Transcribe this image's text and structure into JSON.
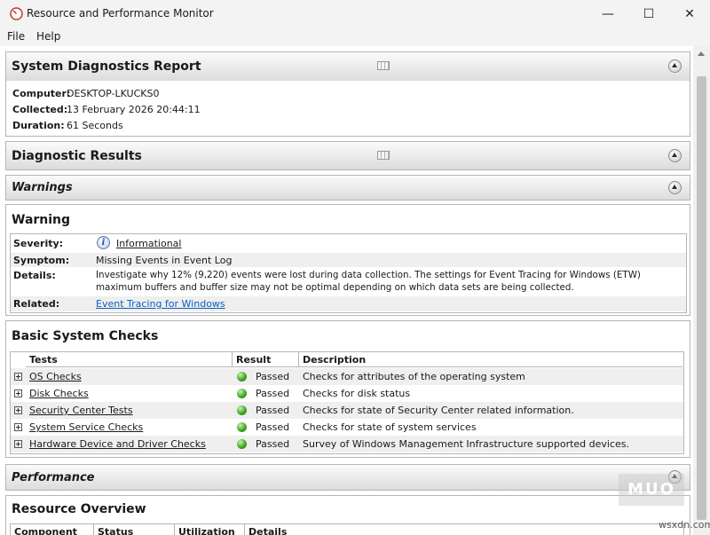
{
  "window": {
    "title": "Resource and Performance Monitor",
    "controls": {
      "minimize": "—",
      "maximize": "☐",
      "close": "✕"
    }
  },
  "menu": {
    "file": "File",
    "help": "Help"
  },
  "report": {
    "title": "System Diagnostics Report",
    "computer_label": "Computer:",
    "computer_value": "DESKTOP-LKUCKS0",
    "collected_label": "Collected:",
    "collected_value": "13 February 2026 20:44:11",
    "duration_label": "Duration:",
    "duration_value": "61 Seconds"
  },
  "diagnostic_results": {
    "title": "Diagnostic Results"
  },
  "warnings": {
    "title": "Warnings"
  },
  "warning": {
    "title": "Warning",
    "severity_label": "Severity:",
    "severity_value": "Informational",
    "symptom_label": "Symptom:",
    "symptom_value": "Missing Events in Event Log",
    "details_label": "Details:",
    "details_line1": "Investigate why 12% (9,220) events were lost during data collection. The settings for Event Tracing for Windows (ETW)",
    "details_line2": "maximum buffers and buffer size may not be optimal depending on which data sets are being collected.",
    "related_label": "Related:",
    "related_value": "Event Tracing for Windows"
  },
  "basic_checks": {
    "title": "Basic System Checks",
    "columns": {
      "tests": "Tests",
      "result": "Result",
      "description": "Description"
    },
    "rows": [
      {
        "test": "OS Checks",
        "result": "Passed",
        "description": "Checks for attributes of the operating system"
      },
      {
        "test": "Disk Checks",
        "result": "Passed",
        "description": "Checks for disk status"
      },
      {
        "test": "Security Center Tests",
        "result": "Passed",
        "description": "Checks for state of Security Center related information."
      },
      {
        "test": "System Service Checks",
        "result": "Passed",
        "description": "Checks for state of system services"
      },
      {
        "test": "Hardware Device and Driver Checks",
        "result": "Passed",
        "description": "Survey of Windows Management Infrastructure supported devices."
      }
    ]
  },
  "performance": {
    "title": "Performance"
  },
  "resource_overview": {
    "title": "Resource Overview",
    "columns": {
      "component": "Component",
      "status": "Status",
      "utilization": "Utilization",
      "details": "Details"
    }
  },
  "watermark": {
    "logo": "MUO",
    "site": "wsxdn.com"
  },
  "colors": {
    "link": "#0a5fbd",
    "passed": "#35a51c",
    "header_top": "#fbfbfb",
    "header_bottom": "#dcdcdc"
  }
}
